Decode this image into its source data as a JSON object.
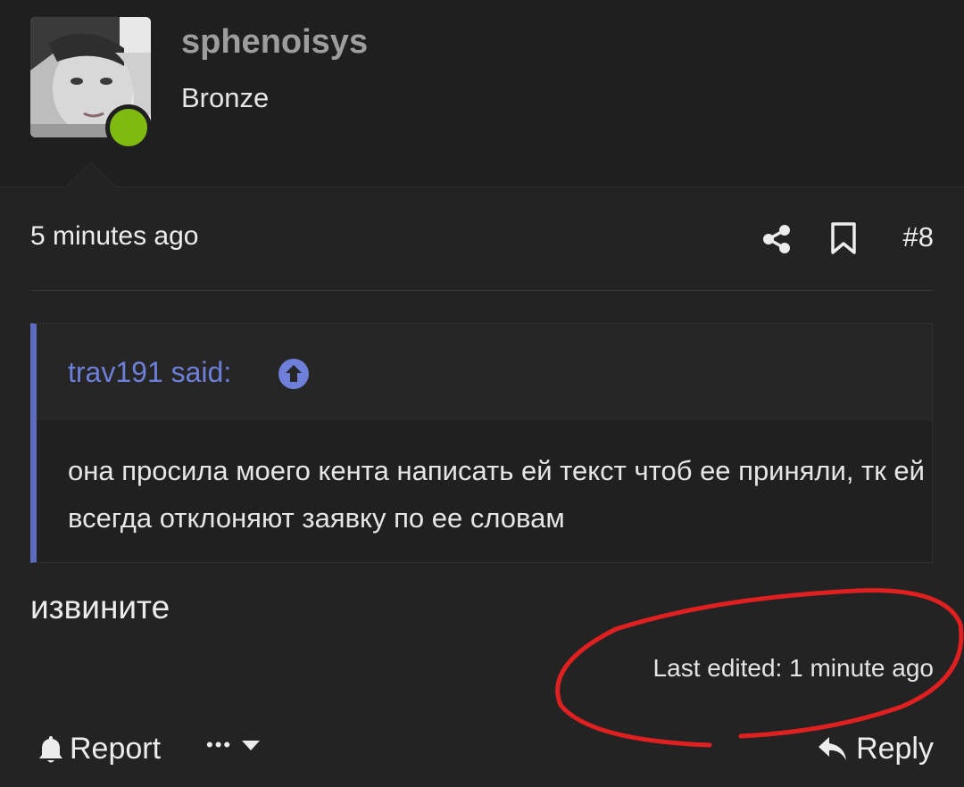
{
  "post": {
    "username": "sphenoisys",
    "rank": "Bronze",
    "time": "5 minutes ago",
    "post_number": "#8",
    "quote": {
      "author": "trav191 said:",
      "text": "она просила моего кента написать ей текст чтоб ее приняли, тк ей всегда отклоняют заявку по ее словам"
    },
    "message": "извините",
    "last_edited": "Last edited: 1 minute ago"
  },
  "actions": {
    "report_label": "Report",
    "more_label": "•••",
    "reply_label": "Reply"
  },
  "icons": [
    "share-icon",
    "bookmark-icon",
    "arrow-up-circle-icon",
    "bell-icon",
    "caret-down-icon",
    "reply-icon"
  ],
  "colors": {
    "background": "#232323",
    "header_background": "#1f1f1f",
    "username": "#9d9d9d",
    "quote_accent": "#5c6bc0",
    "quote_author": "#6d7fd8",
    "online": "#7fba10",
    "annotation": "#e02020"
  }
}
